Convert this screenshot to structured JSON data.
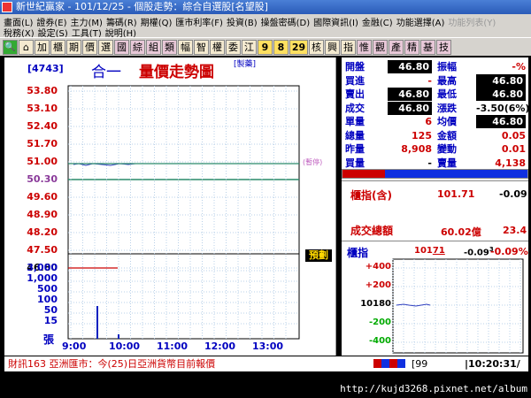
{
  "window": {
    "title": "新世紀贏家 - 101/12/25 - 個股走勢：綜合自選股[名望股]"
  },
  "menu": {
    "row1": [
      {
        "label": "畫面(L)",
        "enabled": true
      },
      {
        "label": "證券(E)",
        "enabled": true
      },
      {
        "label": "主力(M)",
        "enabled": true
      },
      {
        "label": "籌碼(R)",
        "enabled": true
      },
      {
        "label": "期權(Q)",
        "enabled": true
      },
      {
        "label": "匯市利率(F)",
        "enabled": true
      },
      {
        "label": "投資(B)",
        "enabled": true
      },
      {
        "label": "操盤密碼(D)",
        "enabled": true
      },
      {
        "label": "國際資訊(I)",
        "enabled": true
      },
      {
        "label": "金融(C)",
        "enabled": true
      },
      {
        "label": "功能選擇(A)",
        "enabled": true
      },
      {
        "label": "功能列表(Y)",
        "enabled": false
      }
    ],
    "row2": [
      {
        "label": "稅務(X)",
        "enabled": true
      },
      {
        "label": "設定(S)",
        "enabled": true
      },
      {
        "label": "工具(T)",
        "enabled": true
      },
      {
        "label": "說明(H)",
        "enabled": true
      }
    ]
  },
  "toolbar": [
    "加",
    "櫃",
    "期",
    "價",
    "選",
    "國",
    "綜",
    "組",
    "類",
    "幅",
    "智",
    "權",
    "委",
    "江",
    "9",
    "8",
    "29",
    "核",
    "興",
    "指",
    "惟",
    "觀",
    "產",
    "精",
    "基",
    "技"
  ],
  "chart": {
    "code": "[4743]",
    "name": "合一",
    "title": "量價走勢圖",
    "tag": "[製藥]",
    "halt_label": "(暫停)",
    "preview_label": "預劃",
    "price_axis": [
      "53.80",
      "53.10",
      "52.40",
      "51.70",
      "51.00",
      "50.30",
      "49.60",
      "48.90",
      "48.20",
      "47.50",
      "46.80"
    ],
    "volume_axis": [
      "3,000",
      "1,000",
      "500",
      "100",
      "50",
      "15"
    ],
    "volume_unit": "張",
    "time_axis": [
      "9:00",
      "10:00",
      "11:00",
      "12:00",
      "13:00"
    ]
  },
  "quote": {
    "row1": {
      "l1": "開盤",
      "v1": "46.80",
      "l2": "振幅",
      "v2": "-%"
    },
    "row2": {
      "l1": "買進",
      "v1": "-",
      "l2": "最高",
      "v2": "46.80"
    },
    "row3": {
      "l1": "賣出",
      "v1": "46.80",
      "l2": "最低",
      "v2": "46.80"
    },
    "row4": {
      "l1": "成交",
      "v1": "46.80",
      "l2": "漲跌",
      "v2": "-3.50(6%)"
    },
    "row5": {
      "l1": "單量",
      "v1": "6",
      "l2": "均價",
      "v2": "46.80"
    },
    "row6": {
      "l1": "總量",
      "v1": "125",
      "l2": "金額",
      "v2": "0.05"
    },
    "row7": {
      "l1": "昨量",
      "v1": "8,908",
      "l2": "變動",
      "v2": "0.01"
    },
    "row8": {
      "l1": "買量",
      "v1": "-",
      "l2": "賣量",
      "v2": "4,138"
    }
  },
  "index_panel": {
    "label": "櫃指(含)",
    "value": "101.71",
    "change": "-0.09"
  },
  "turnover": {
    "label": "成交總額",
    "value": "60.02億",
    "extra": "23.4"
  },
  "mini_index": {
    "label": "櫃指",
    "value": "101",
    "value_suffix": "71",
    "change": "-0.09",
    "change_sup": "3",
    "pct": "-0.09%",
    "axis": [
      "+400",
      "+200",
      "10180",
      "-200",
      "-400"
    ]
  },
  "status": {
    "news": "財訊163 亞洲匯市：今(25)日亞洲貨幣目前報價",
    "page": "99",
    "time": "10:20:31/"
  },
  "watermark": "http://kujd3268.pixnet.net/album"
}
